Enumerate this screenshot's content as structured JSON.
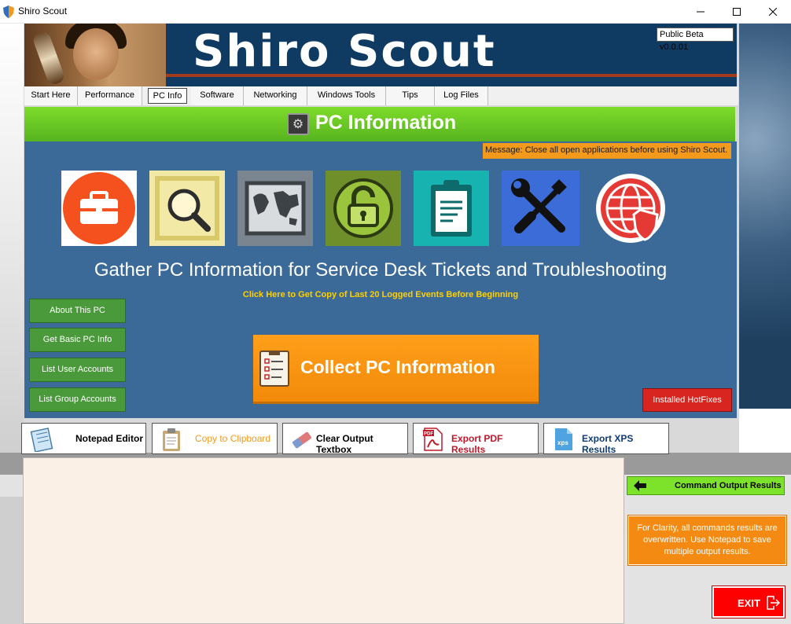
{
  "window": {
    "title": "Shiro Scout"
  },
  "banner": {
    "logo_text": "Shiro Scout",
    "beta_label": "Public Beta v0.0.01"
  },
  "tabs": [
    {
      "label": "Start Here"
    },
    {
      "label": "Performance"
    },
    {
      "label": "PC Info"
    },
    {
      "label": "Software"
    },
    {
      "label": "Networking"
    },
    {
      "label": "Windows Tools"
    },
    {
      "label": "Tips"
    },
    {
      "label": "Log Files"
    }
  ],
  "section": {
    "title": "PC Information",
    "icon": "pc-info-gear-icon"
  },
  "message": "Message: Close all open applications before using Shiro Scout.",
  "tiles": [
    {
      "icon": "toolbox-icon",
      "bg": "#ffffff"
    },
    {
      "icon": "magnifier-icon",
      "bg": "#f2e9a6"
    },
    {
      "icon": "world-map-icon",
      "bg": "#7b8590"
    },
    {
      "icon": "unlocked-padlock-icon",
      "bg": "#6f8f2a"
    },
    {
      "icon": "clipboard-icon",
      "bg": "#17b3b0"
    },
    {
      "icon": "wrench-screwdriver-icon",
      "bg": "#3b6cd8"
    },
    {
      "icon": "globe-shield-icon",
      "bg": "#3c6a98"
    }
  ],
  "subtitle": "Gather PC Information for Service Desk Tickets and Troubleshooting",
  "events_link": "Click Here to Get Copy of Last 20 Logged Events Before Beginning",
  "side_buttons": [
    {
      "label": "About This PC"
    },
    {
      "label": "Get Basic PC Info"
    },
    {
      "label": "List User Accounts"
    },
    {
      "label": "List Group Accounts"
    }
  ],
  "collect_button": {
    "label": "Collect PC Information"
  },
  "hotfix_button": {
    "label": "Installed HotFixes"
  },
  "toolbar": [
    {
      "label": "Notepad Editor",
      "color": "#000000",
      "icon": "notepad-icon"
    },
    {
      "label": "Copy to Clipboard",
      "color": "#f39a1c",
      "icon": "clipboard-copy-icon"
    },
    {
      "label": "Clear Output Textbox",
      "color": "#000000",
      "icon": "eraser-icon"
    },
    {
      "label": "Export PDF Results",
      "color": "#c0182a",
      "icon": "pdf-icon"
    },
    {
      "label": "Export XPS Results",
      "color": "#0f3b73",
      "icon": "xps-icon"
    }
  ],
  "output": {
    "value": ""
  },
  "command_output": {
    "label": "Command Output Results"
  },
  "clarity_note": "For Clarity, all commands results are overwritten. Use Notepad to save multiple output results.",
  "exit_button": {
    "label": "EXIT"
  }
}
